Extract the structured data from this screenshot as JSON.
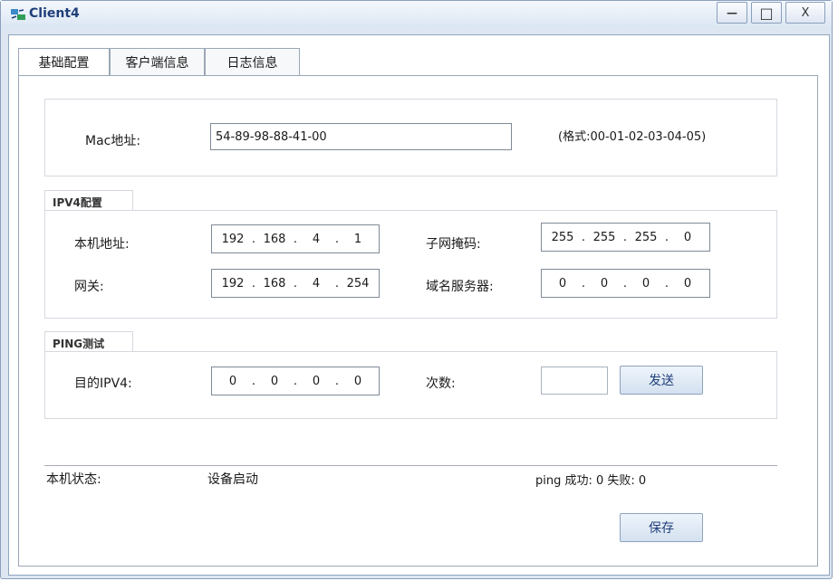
{
  "window": {
    "title": "Client4",
    "min_glyph": "—",
    "max_glyph": "□",
    "close_glyph": "X"
  },
  "tabs": [
    {
      "label": "基础配置"
    },
    {
      "label": "客户端信息"
    },
    {
      "label": "日志信息"
    }
  ],
  "mac": {
    "label": "Mac地址:",
    "value": "54-89-98-88-41-00",
    "format_hint": "(格式:00-01-02-03-04-05)"
  },
  "ipv4": {
    "group_label": "IPV4配置",
    "local_ip_label": "本机地址:",
    "local_ip": [
      "192",
      "168",
      "4",
      "1"
    ],
    "subnet_label": "子网掩码:",
    "subnet": [
      "255",
      "255",
      "255",
      "0"
    ],
    "gateway_label": "网关:",
    "gateway": [
      "192",
      "168",
      "4",
      "254"
    ],
    "dns_label": "域名服务器:",
    "dns": [
      "0",
      "0",
      "0",
      "0"
    ]
  },
  "ping": {
    "group_label": "PING测试",
    "target_label": "目的IPV4:",
    "target": [
      "0",
      "0",
      "0",
      "0"
    ],
    "count_label": "次数:",
    "count_value": "",
    "send_label": "发送"
  },
  "status": {
    "label": "本机状态:",
    "value": "设备启动",
    "ping_result": "ping 成功: 0 失败: 0"
  },
  "save_label": "保存",
  "colors": {
    "accent": "#1f3f7a",
    "window_bg": "#dde6f1",
    "border": "#8ba0bc"
  }
}
